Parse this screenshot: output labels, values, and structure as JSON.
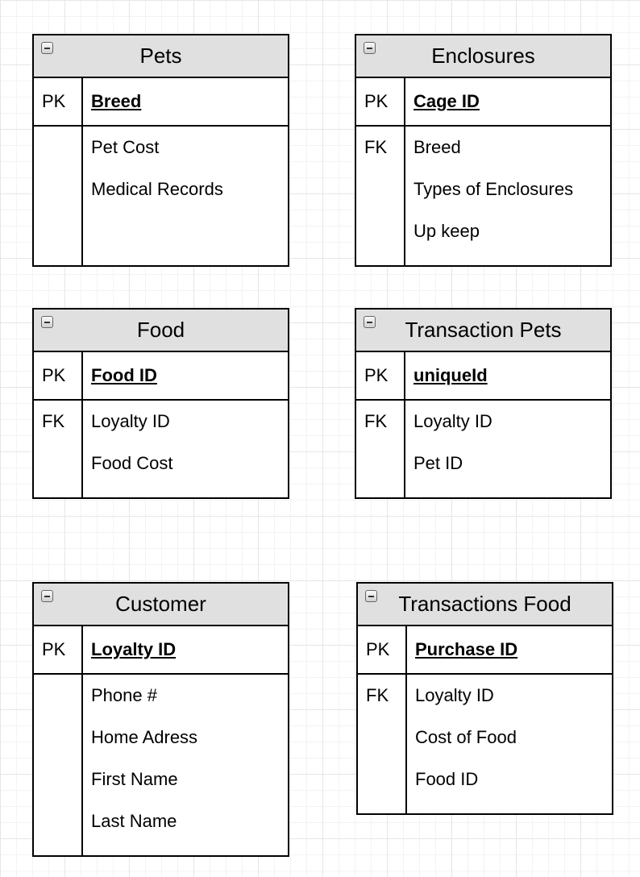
{
  "tables": {
    "pets": {
      "title": "Pets",
      "pk_label": "PK",
      "pk_field": "Breed",
      "fk_label": "",
      "fields": [
        "Pet Cost",
        "Medical Records"
      ]
    },
    "enclosures": {
      "title": "Enclosures",
      "pk_label": "PK",
      "pk_field": "Cage ID",
      "fk_label": "FK",
      "fields": [
        "Breed",
        "Types of Enclosures",
        "Up keep"
      ]
    },
    "food": {
      "title": "Food",
      "pk_label": "PK",
      "pk_field": "Food ID",
      "fk_label": "FK",
      "fields": [
        "Loyalty ID",
        "Food Cost"
      ]
    },
    "transaction_pets": {
      "title": "Transaction Pets",
      "pk_label": "PK",
      "pk_field": "uniqueId",
      "fk_label": "FK",
      "fields": [
        "Loyalty ID",
        "Pet ID"
      ]
    },
    "customer": {
      "title": "Customer",
      "pk_label": "PK",
      "pk_field": "Loyalty ID",
      "fk_label": "",
      "fields": [
        "Phone #",
        "Home Adress",
        "First Name",
        "Last Name"
      ]
    },
    "transactions_food": {
      "title": "Transactions Food",
      "pk_label": "PK",
      "pk_field": "Purchase ID",
      "fk_label": "FK",
      "fields": [
        "Loyalty ID",
        "Cost of Food",
        "Food ID"
      ]
    }
  }
}
